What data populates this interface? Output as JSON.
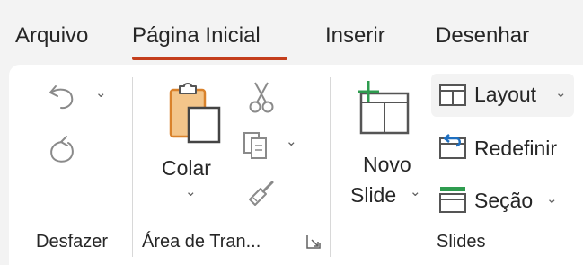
{
  "tabs": [
    {
      "label": "Arquivo"
    },
    {
      "label": "Página Inicial"
    },
    {
      "label": "Inserir"
    },
    {
      "label": "Desenhar"
    }
  ],
  "groups": {
    "undo": {
      "label": "Desfazer"
    },
    "clipboard": {
      "label": "Área de Tran...",
      "paste_label": "Colar"
    },
    "slides": {
      "label": "Slides",
      "new_slide_line1": "Novo",
      "new_slide_line2": "Slide",
      "layout_label": "Layout",
      "reset_label": "Redefinir",
      "section_label": "Seção"
    }
  },
  "icons": {
    "undo": "undo-icon",
    "redo": "redo-icon",
    "paste": "clipboard-icon",
    "cut": "scissors-icon",
    "copy": "copy-icon",
    "format_painter": "paintbrush-icon",
    "new_slide": "new-slide-icon",
    "layout": "layout-icon",
    "reset": "reset-icon",
    "section": "section-icon",
    "dialog_launcher": "dialog-launcher-icon"
  },
  "colors": {
    "accent": "#c43e1c",
    "clipboard_orange": "#d9822b",
    "green": "#2e9c4f",
    "blue": "#1e6fc0"
  }
}
